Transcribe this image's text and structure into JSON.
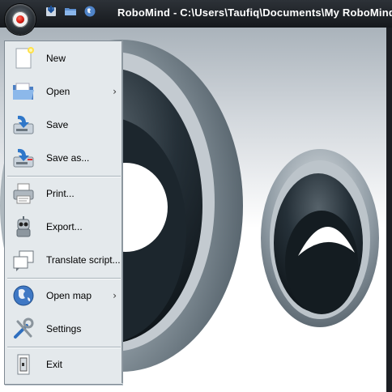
{
  "window": {
    "title": "RoboMind - C:\\Users\\Taufiq\\Documents\\My RoboMind"
  },
  "app_button": {
    "icon": "robot-eye-icon",
    "accent": "#d81c12"
  },
  "quick_access": [
    {
      "name": "save-icon"
    },
    {
      "name": "open-folder-icon"
    },
    {
      "name": "globe-icon"
    }
  ],
  "menu": {
    "items": [
      {
        "label": "New",
        "icon": "new-file-icon",
        "has_submenu": false
      },
      {
        "label": "Open",
        "icon": "open-folder-icon",
        "has_submenu": true,
        "arrow": "›"
      },
      {
        "label": "Save",
        "icon": "save-icon",
        "has_submenu": false
      },
      {
        "label": "Save as...",
        "icon": "save-as-icon",
        "has_submenu": false
      },
      {
        "label": "Print...",
        "icon": "printer-icon",
        "has_submenu": false
      },
      {
        "label": "Export...",
        "icon": "robot-export-icon",
        "has_submenu": false
      },
      {
        "label": "Translate script...",
        "icon": "translate-script-icon",
        "has_submenu": false
      },
      {
        "label": "Open map",
        "icon": "globe-map-icon",
        "has_submenu": true,
        "arrow": "›"
      },
      {
        "label": "Settings",
        "icon": "settings-tools-icon",
        "has_submenu": false
      },
      {
        "label": "Exit",
        "icon": "exit-door-icon",
        "has_submenu": false
      }
    ]
  },
  "colors": {
    "titlebar": "#1c1f24",
    "menu_bg": "#e4e9ec",
    "eye_dark": "#1b252b"
  }
}
